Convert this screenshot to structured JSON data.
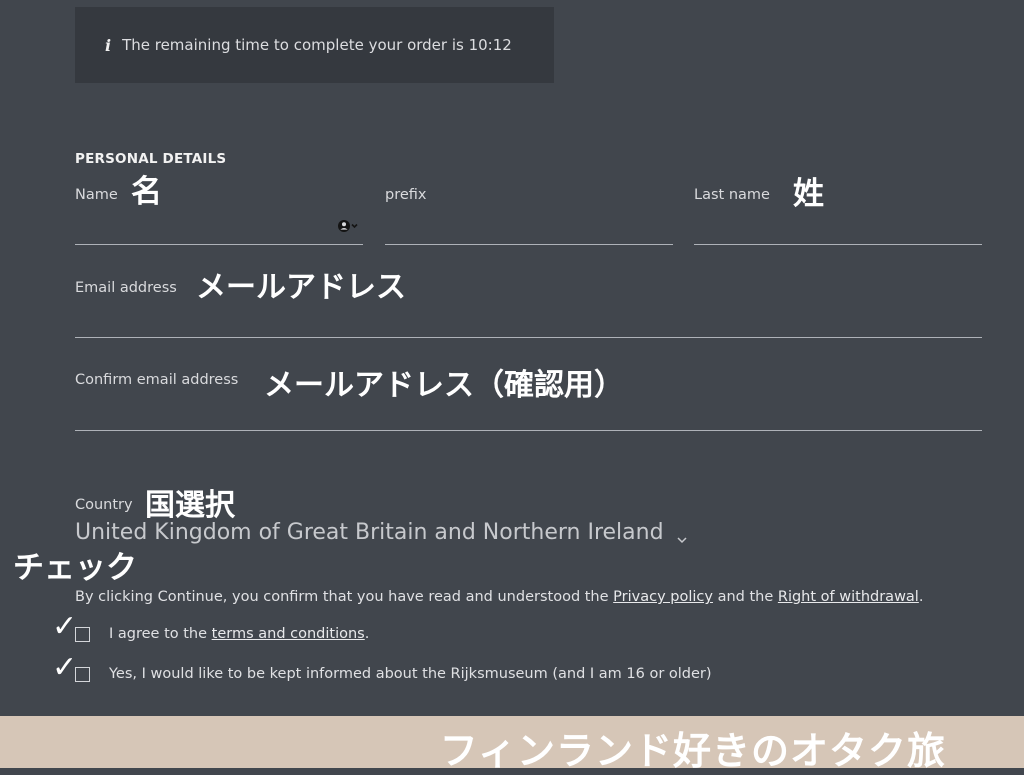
{
  "notice": {
    "icon": "info-icon",
    "icon_glyph": "i",
    "text": "The remaining time to complete your order is 10:12"
  },
  "personal_details": {
    "section_title": "PERSONAL DETAILS",
    "name_label": "Name",
    "name_value": "",
    "prefix_label": "prefix",
    "prefix_value": "",
    "last_name_label": "Last name",
    "last_name_value": "",
    "email_label": "Email address",
    "email_value": "",
    "confirm_email_label": "Confirm email address",
    "confirm_email_value": "",
    "country_label": "Country",
    "country_selected": "United Kingdom of Great Britain and Northern Ireland"
  },
  "consent": {
    "text_before": "By clicking Continue, you confirm that you have read and understood the ",
    "privacy_link": "Privacy policy",
    "text_middle": " and the ",
    "withdrawal_link": "Right of withdrawal",
    "text_after": ".",
    "terms_prefix": "I agree to the ",
    "terms_link": "terms and conditions",
    "terms_suffix": ".",
    "newsletter_label": "Yes, I would like to be kept informed about the Rijksmuseum (and I am 16 or older)",
    "terms_checked": false,
    "newsletter_checked": false
  },
  "annotations": {
    "name_jp": "名",
    "last_name_jp": "姓",
    "email_jp": "メールアドレス",
    "confirm_email_jp": "メールアドレス（確認用）",
    "country_jp": "国選択",
    "check_jp": "チェック",
    "check_mark": "✓"
  },
  "footer": {
    "text": "フィンランド好きのオタク旅"
  },
  "colors": {
    "background": "#41464d",
    "notice_background": "#35393f",
    "footer_band": "#d6c6b7"
  }
}
